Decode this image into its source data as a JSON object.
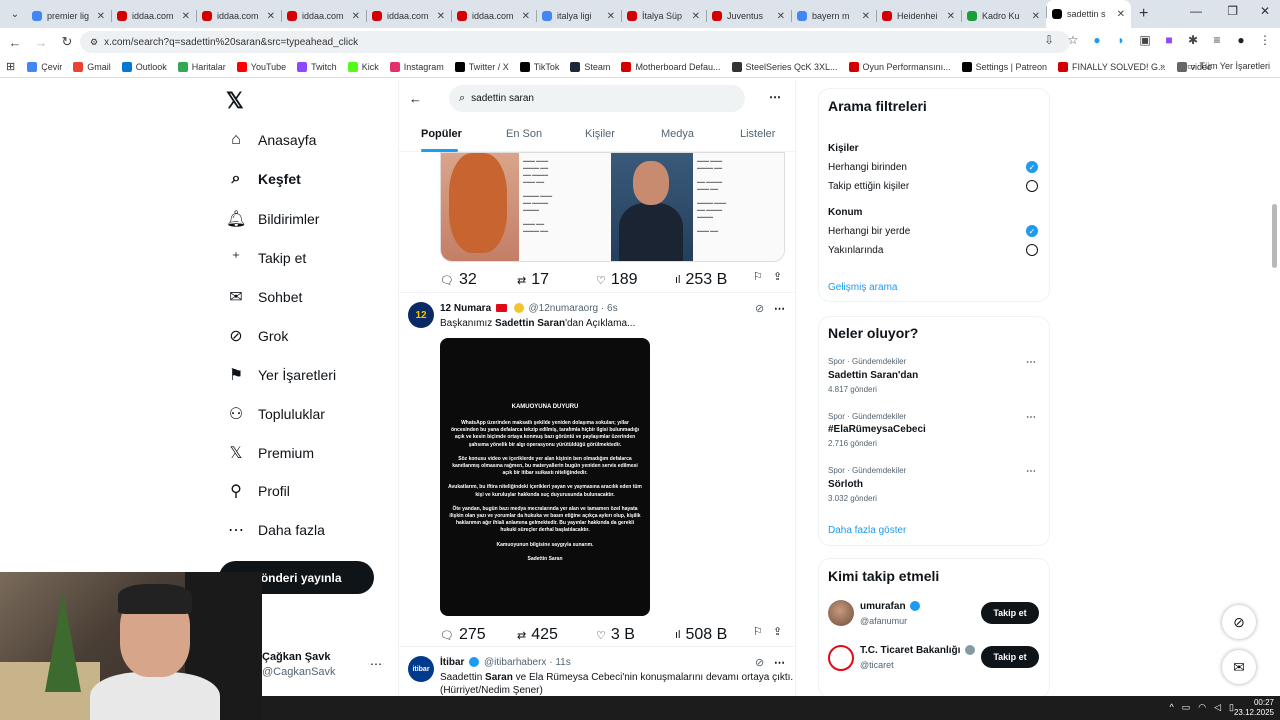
{
  "browser": {
    "tabs": [
      {
        "label": "premier lig",
        "color": "#4285f4"
      },
      {
        "label": "iddaa.com",
        "color": "#d40000"
      },
      {
        "label": "iddaa.com",
        "color": "#d40000"
      },
      {
        "label": "iddaa.com",
        "color": "#d40000"
      },
      {
        "label": "iddaa.com",
        "color": "#d40000"
      },
      {
        "label": "iddaa.com",
        "color": "#d40000"
      },
      {
        "label": "italya ligi",
        "color": "#4285f4"
      },
      {
        "label": "İtalya Süp",
        "color": "#d40000"
      },
      {
        "label": "Juventus",
        "color": "#d40000"
      },
      {
        "label": "bayern m",
        "color": "#4285f4"
      },
      {
        "label": "Heidenhei",
        "color": "#d40000"
      },
      {
        "label": "Kadro Ku",
        "color": "#1a9e3a"
      },
      {
        "label": "sadettin s",
        "color": "#000000"
      }
    ],
    "url": "x.com/search?q=sadettin%20saran&src=typeahead_click",
    "bookmarks": [
      {
        "label": "Çevir",
        "color": "#4285f4"
      },
      {
        "label": "Gmail",
        "color": "#ea4335"
      },
      {
        "label": "Outlook",
        "color": "#0078d4"
      },
      {
        "label": "Haritalar",
        "color": "#34a853"
      },
      {
        "label": "YouTube",
        "color": "#ff0000"
      },
      {
        "label": "Twitch",
        "color": "#9146ff"
      },
      {
        "label": "Kick",
        "color": "#53fc18"
      },
      {
        "label": "Instagram",
        "color": "#e1306c"
      },
      {
        "label": "Twitter / X",
        "color": "#000000"
      },
      {
        "label": "TikTok",
        "color": "#000000"
      },
      {
        "label": "Steam",
        "color": "#1b2838"
      },
      {
        "label": "Motherboard Defau...",
        "color": "#d40000"
      },
      {
        "label": "SteelSeries QcK 3XL...",
        "color": "#333333"
      },
      {
        "label": "Oyun Performansını...",
        "color": "#d40000"
      },
      {
        "label": "Settings | Patreon",
        "color": "#000000"
      },
      {
        "label": "FINALLY SOLVED! G...",
        "color": "#d40000"
      },
      {
        "label": "video",
        "color": "#666666"
      }
    ],
    "all_bookmarks": "Tüm Yer İşaretleri"
  },
  "nav": {
    "items": [
      {
        "label": "Anasayfa",
        "icon": "⌂"
      },
      {
        "label": "Keşfet",
        "icon": "⌕"
      },
      {
        "label": "Bildirimler",
        "icon": "🔔︎"
      },
      {
        "label": "Takip et",
        "icon": "⁺"
      },
      {
        "label": "Sohbet",
        "icon": "✉"
      },
      {
        "label": "Grok",
        "icon": "⊘"
      },
      {
        "label": "Yer İşaretleri",
        "icon": "⚑"
      },
      {
        "label": "Topluluklar",
        "icon": "⚇"
      },
      {
        "label": "Premium",
        "icon": "𝕏"
      },
      {
        "label": "Profil",
        "icon": "⚲"
      },
      {
        "label": "Daha fazla",
        "icon": "⋯"
      }
    ],
    "post_button": "Gönderi yayınla",
    "account_name": "Çağkan Şavk",
    "account_handle": "@CagkanSavk"
  },
  "search": {
    "query": "sadettin saran",
    "tabs": [
      "Popüler",
      "En Son",
      "Kişiler",
      "Medya",
      "Listeler"
    ]
  },
  "tweets": [
    {
      "replies": "32",
      "retweets": "17",
      "likes": "189",
      "views": "253 B"
    },
    {
      "name": "12 Numara",
      "handle": "@12numaraorg",
      "time": "6s",
      "text_pre": "Başkanımız ",
      "text_bold": "Sadettin Saran",
      "text_post": "'dan Açıklama...",
      "replies": "275",
      "retweets": "425",
      "likes": "3 B",
      "views": "508 B"
    },
    {
      "name": "İtibar",
      "handle": "@itibarhaberx",
      "time": "11s",
      "text_pre": "Saadettin ",
      "text_bold": "Saran",
      "text_post": " ve Ela Rümeysa Cebeci'nin konuşmalarını devamı ortaya çıktı.",
      "text_line2": "(Hürriyet/Nedim Şener)"
    }
  ],
  "notice": {
    "heading": "KAMUOYUNA DUYURU",
    "p1": "WhatsApp üzerinden maksatlı şekilde yeniden dolaşıma sokulan; yıllar öncesinden bu yana defalarca tekzip edilmiş, tarafımla hiçbir ilgisi bulunmadığı açık ve kesin biçimde ortaya konmuş bazı görüntü ve paylaşımlar üzerinden şahsıma yönelik bir algı operasyonu yürütüldüğü görülmektedir.",
    "p2": "Söz konusu video ve içeriklerde yer alan kişinin ben olmadığım defalarca kanıtlanmış olmasına rağmen, bu materyallerin bugün yeniden servis edilmesi açık bir itibar suikastı niteliğindedir.",
    "p3": "Avukatlarım, bu iftira niteliğindeki içerikleri yayan ve yaymasına aracılık eden tüm kişi ve kuruluşlar hakkında suç duyurusunda bulunacaktır.",
    "p4": "Öte yandan, bugün bazı medya mecralarında yer alan ve tamamen özel hayata ilişkin olan yazı ve yorumlar da hukuka ve basın etiğine açıkça aykırı olup, kişilik haklarımın ağır ihlali anlamına gelmektedir. Bu yayınlar hakkında da gerekli hukuki süreçler derhal başlatılacaktır.",
    "p5": "Kamuoyunun bilgisine saygıyla sunarım.",
    "sign": "Sadettin Saran"
  },
  "filters": {
    "title": "Arama filtreleri",
    "people_label": "Kişiler",
    "people_opts": [
      "Herhangi birinden",
      "Takip ettiğin kişiler"
    ],
    "location_label": "Konum",
    "location_opts": [
      "Herhangi bir yerde",
      "Yakınlarında"
    ],
    "advanced": "Gelişmiş arama"
  },
  "trends": {
    "title": "Neler oluyor?",
    "items": [
      {
        "context": "Spor · Gündemdekiler",
        "topic": "Sadettin Saran'dan",
        "count": "4.817 gönderi"
      },
      {
        "context": "Spor · Gündemdekiler",
        "topic": "#ElaRümeysaCebeci",
        "count": "2.716 gönderi"
      },
      {
        "context": "Spor · Gündemdekiler",
        "topic": "Sörloth",
        "count": "3.032 gönderi"
      }
    ],
    "more": "Daha fazla göster"
  },
  "who": {
    "title": "Kimi takip etmeli",
    "items": [
      {
        "name": "umurafan",
        "handle": "@afanumur",
        "button": "Takip et"
      },
      {
        "name": "T.C. Ticaret Bakanlığı",
        "handle": "@ticaret",
        "button": "Takip et"
      }
    ]
  },
  "clock": {
    "time": "00:27",
    "date": "23.12.2025"
  },
  "colors": {
    "accent": "#1d9bf0",
    "text": "#0f1419",
    "muted": "#536471"
  }
}
